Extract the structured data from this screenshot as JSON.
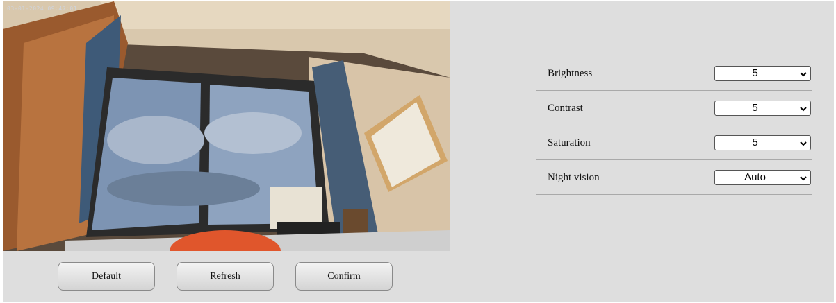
{
  "preview": {
    "timestamp": "03-01-2024 09:47:01",
    "icon": "camera-feed"
  },
  "buttons": {
    "default_label": "Default",
    "refresh_label": "Refresh",
    "confirm_label": "Confirm"
  },
  "settings": [
    {
      "label": "Brightness",
      "value": "5"
    },
    {
      "label": "Contrast",
      "value": "5"
    },
    {
      "label": "Saturation",
      "value": "5"
    },
    {
      "label": "Night vision",
      "value": "Auto"
    }
  ],
  "colors": {
    "panel_bg": "#dedede",
    "divider": "#a9a9a9",
    "button_border": "#8a8a8a"
  }
}
